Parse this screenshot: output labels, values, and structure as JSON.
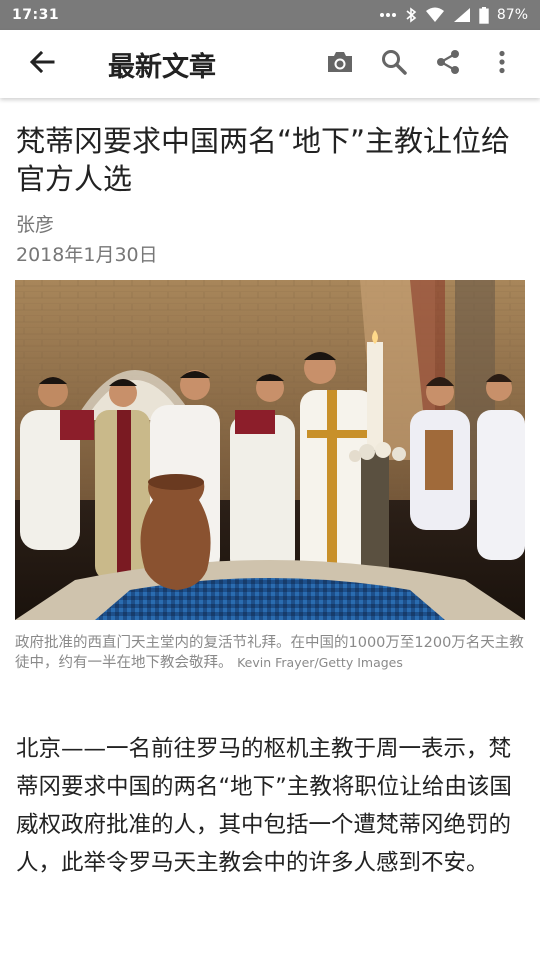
{
  "status_bar": {
    "time": "17:31",
    "battery": "87%",
    "icons": [
      "more-dots-icon",
      "bluetooth-icon",
      "wifi-icon",
      "signal-icon",
      "battery-icon"
    ]
  },
  "app_bar": {
    "title": "最新文章",
    "icons": [
      "back-arrow-icon",
      "camera-icon",
      "search-icon",
      "share-icon",
      "overflow-menu-icon"
    ]
  },
  "article": {
    "title": "梵蒂冈要求中国两名“地下”主教让位给官方人选",
    "author": "张彦",
    "date": "2018年1月30日",
    "caption": "政府批准的西直门天主堂内的复活节礼拜。在中国的1000万至1200万名天主教徒中，约有一半在地下教会敬拜。",
    "caption_credit": "Kevin Frayer/Getty Images",
    "body": "北京——一名前往罗马的枢机主教于周一表示，梵蒂冈要求中国的两名“地下”主教将职位让给由该国威权政府批准的人，其中包括一个遭梵蒂冈绝罚的人，此举令罗马天主教会中的许多人感到不安。"
  }
}
